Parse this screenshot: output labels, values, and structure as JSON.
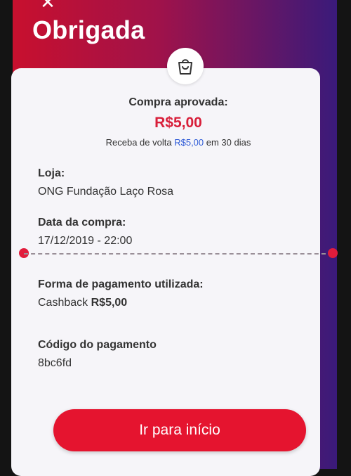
{
  "header": {
    "close_icon": "close-icon",
    "title": "Obrigada"
  },
  "summary": {
    "bag_icon": "shopping-bag-icon",
    "approved_label": "Compra aprovada:",
    "amount": "R$5,00",
    "cashback_prefix": "Receba de volta",
    "cashback_amount": "R$5,00",
    "cashback_suffix": "em 30 dias"
  },
  "store": {
    "label": "Loja:",
    "value": "ONG Fundação Laço Rosa"
  },
  "purchase_date": {
    "label": "Data da compra:",
    "value": "17/12/2019 - 22:00"
  },
  "payment_method": {
    "label": "Forma de pagamento utilizada:",
    "method": "Cashback",
    "amount": "R$5,00"
  },
  "payment_code": {
    "label": "Código do pagamento",
    "value": "8bc6fd"
  },
  "actions": {
    "home_button": "Ir para início"
  },
  "colors": {
    "accent_red": "#e5142f",
    "amount_red": "#d81f3a",
    "cashback_blue": "#2d5ad6",
    "header_gradient_start": "#c8102e",
    "header_gradient_end": "#3a1a7a"
  }
}
